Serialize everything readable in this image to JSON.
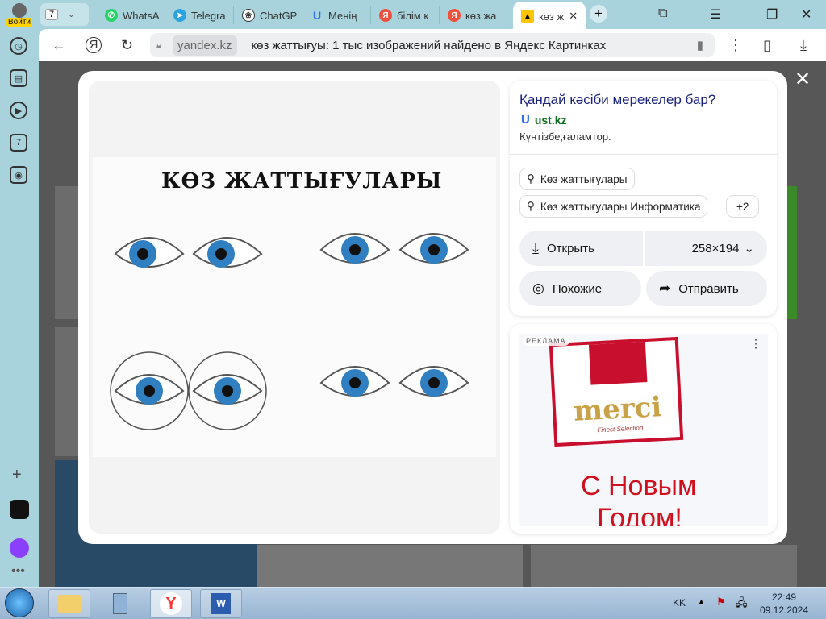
{
  "browser": {
    "login_label": "Войти",
    "tab_count": "7",
    "tabs": [
      {
        "label": "WhatsA",
        "color": "#25d366",
        "icon": "whatsapp-icon"
      },
      {
        "label": "Telegra",
        "color": "#2aa3e0",
        "icon": "telegram-icon"
      },
      {
        "label": "ChatGP",
        "color": "#333333",
        "icon": "chatgpt-icon"
      },
      {
        "label": "Менің",
        "color": "#2d6cf0",
        "icon": "ustkz-icon"
      },
      {
        "label": "білім к",
        "color": "#f0503c",
        "icon": "yandex-icon"
      },
      {
        "label": "көз жа",
        "color": "#f0503c",
        "icon": "yandex-icon"
      }
    ],
    "active_tab": "көз ж",
    "domain": "yandex.kz",
    "page_title": "көз жаттығуы: 1 тыс изображений найдено в Яндекс Картинках"
  },
  "sidebar": {
    "counter": "7"
  },
  "viewer": {
    "image_title": "КӨЗ ЖАТТЫҒУЛАРЫ",
    "title": "Қандай кәсіби мерекелер бар?",
    "source": "ust.kz",
    "description": "Күнтізбе,ғаламтор.",
    "tags": [
      "Көз жаттығулары",
      "Көз жаттығулары Информатика"
    ],
    "more_tags": "+2",
    "open_label": "Открыть",
    "size": "258×194",
    "similar_label": "Похожие",
    "share_label": "Отправить",
    "ad": {
      "badge": "РЕКЛАМА",
      "brand": "merci",
      "subbrand": "Finest Selection",
      "greeting1": "С Новым",
      "greeting2": "Годом!"
    }
  },
  "taskbar": {
    "lang": "KK",
    "time": "22:49",
    "date": "09.12.2024"
  }
}
